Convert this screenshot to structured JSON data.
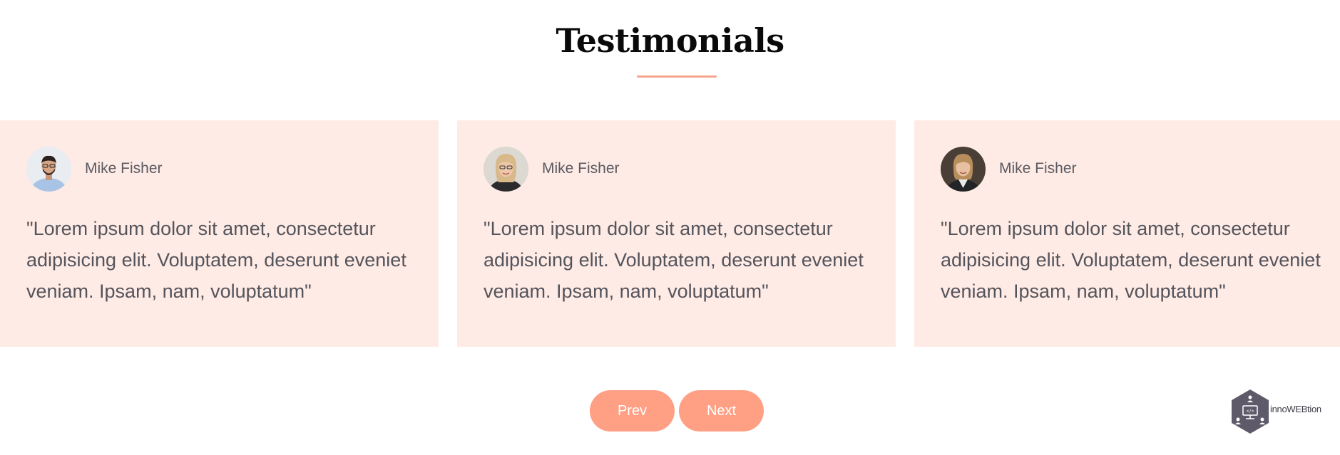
{
  "section": {
    "title": "Testimonials"
  },
  "testimonials": [
    {
      "name": "Mike Fisher",
      "quote": "\"Lorem ipsum dolor sit amet, consectetur adipisicing elit. Voluptatem, deserunt eveniet veniam. Ipsam, nam, voluptatum\""
    },
    {
      "name": "Mike Fisher",
      "quote": "\"Lorem ipsum dolor sit amet, consectetur adipisicing elit. Voluptatem, deserunt eveniet veniam. Ipsam, nam, voluptatum\""
    },
    {
      "name": "Mike Fisher",
      "quote": "\"Lorem ipsum dolor sit amet, consectetur adipisicing elit. Voluptatem, deserunt eveniet veniam. Ipsam, nam, voluptatum\""
    }
  ],
  "controls": {
    "prev_label": "Prev",
    "next_label": "Next"
  },
  "brand": {
    "name": "innoWEBtion",
    "icon": "hexagon-network-logo"
  },
  "colors": {
    "accent": "#ff9f84",
    "card_bg": "#ffebe5",
    "underline": "#f7a58a"
  }
}
